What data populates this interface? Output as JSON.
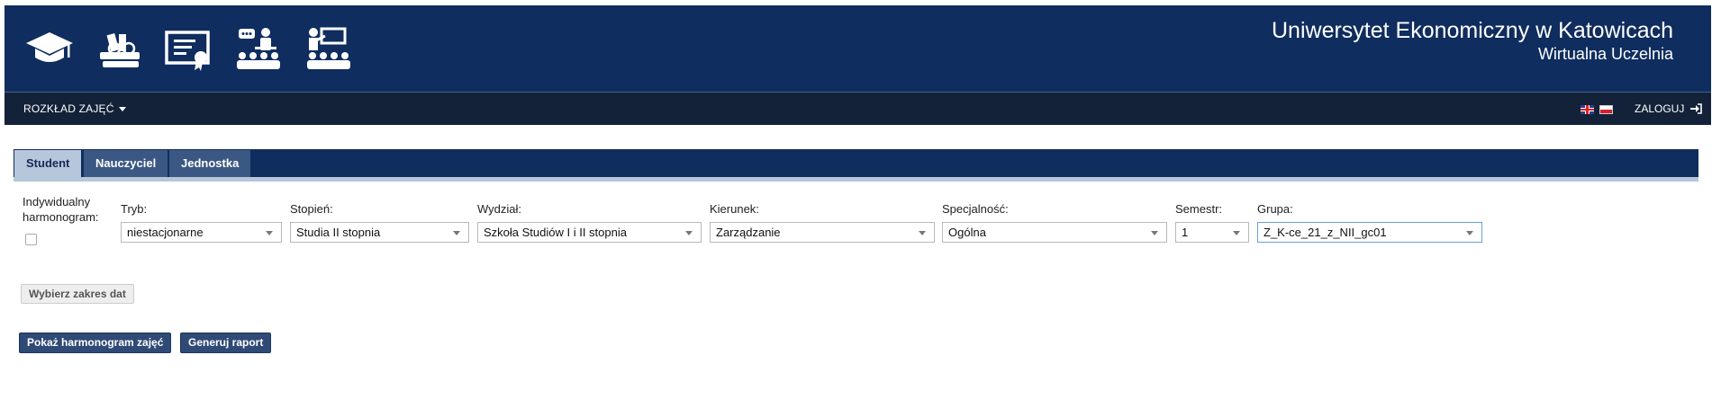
{
  "header": {
    "title": "Uniwersytet Ekonomiczny w Katowicach",
    "subtitle": "Wirtualna Uczelnia",
    "icons": [
      "graduation-cap-icon",
      "books-icon",
      "certificate-icon",
      "lecture-icon",
      "teacher-board-icon"
    ]
  },
  "menu": {
    "schedule": "ROZKŁAD ZAJĘĆ",
    "login": "ZALOGUJ",
    "flags": [
      "flag-uk-icon",
      "flag-pl-icon"
    ]
  },
  "tabs": [
    {
      "label": "Student",
      "active": true
    },
    {
      "label": "Nauczyciel",
      "active": false
    },
    {
      "label": "Jednostka",
      "active": false
    }
  ],
  "form": {
    "individual_label_1": "Indywidualny",
    "individual_label_2": "harmonogram:",
    "individual_checked": false,
    "tryb": {
      "label": "Tryb:",
      "value": "niestacjonarne"
    },
    "stopien": {
      "label": "Stopień:",
      "value": "Studia II stopnia"
    },
    "wydzial": {
      "label": "Wydział:",
      "value": "Szkoła Studiów I i II stopnia"
    },
    "kierunek": {
      "label": "Kierunek:",
      "value": "Zarządzanie"
    },
    "specjalnosc": {
      "label": "Specjalność:",
      "value": "Ogólna"
    },
    "semestr": {
      "label": "Semestr:",
      "value": "1"
    },
    "grupa": {
      "label": "Grupa:",
      "value": "Z_K-ce_21_z_NII_gc01"
    }
  },
  "buttons": {
    "date_range": "Wybierz zakres dat",
    "show_schedule": "Pokaż harmonogram zajęć",
    "generate_report": "Generuj raport"
  },
  "colors": {
    "header_bg": "#0f2d5e",
    "menubar_bg": "#132238",
    "tab_active_bg": "#b6c6db",
    "button_dark": "#2f4a76"
  }
}
